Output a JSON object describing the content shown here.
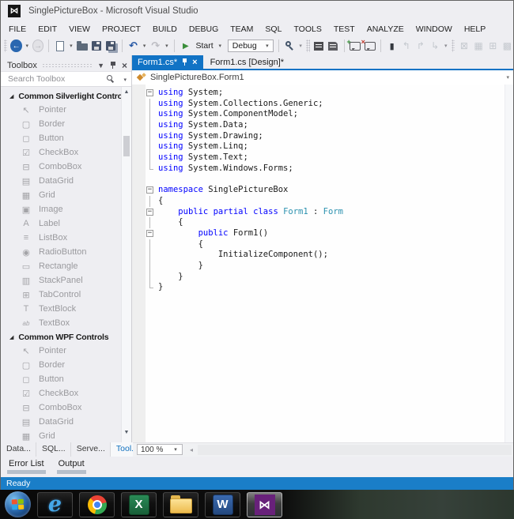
{
  "window": {
    "title": "SinglePictureBox - Microsoft Visual Studio"
  },
  "menu": [
    "FILE",
    "EDIT",
    "VIEW",
    "PROJECT",
    "BUILD",
    "DEBUG",
    "TEAM",
    "SQL",
    "TOOLS",
    "TEST",
    "ANALYZE",
    "WINDOW",
    "HELP"
  ],
  "toolbar": {
    "start_label": "Start",
    "debug_value": "Debug"
  },
  "icons": {
    "vs_logo": "⋈",
    "back": "←",
    "forward": "→",
    "caret": "▾",
    "undo": "↶",
    "redo": "↷",
    "start": "▶",
    "bookmark": "▮",
    "prev_bookmark": "↰",
    "next_bookmark": "↱",
    "clear_bookmarks": "↳",
    "grid1": "⊠",
    "grid2": "▦",
    "grid3": "⊞",
    "grid4": "▩",
    "expander": "◢",
    "fold": "−",
    "close": "×",
    "plus": "+",
    "cross": "×",
    "scroll_up": "▲",
    "scroll_down": "▼",
    "hscroll_left": "◂",
    "crumb_caret": "▾",
    "search_caret": "▾"
  },
  "toolbox": {
    "title": "Toolbox",
    "search_placeholder": "Search Toolbox",
    "groups": [
      {
        "label": "Common Silverlight Controls",
        "items": [
          {
            "label": "Pointer",
            "icon": "pointer-icon",
            "glyph": "↖"
          },
          {
            "label": "Border",
            "icon": "border-icon",
            "glyph": "▢"
          },
          {
            "label": "Button",
            "icon": "button-icon",
            "glyph": "◻"
          },
          {
            "label": "CheckBox",
            "icon": "checkbox-icon",
            "glyph": "☑"
          },
          {
            "label": "ComboBox",
            "icon": "combobox-icon",
            "glyph": "⊟"
          },
          {
            "label": "DataGrid",
            "icon": "datagrid-icon",
            "glyph": "▤"
          },
          {
            "label": "Grid",
            "icon": "grid-icon",
            "glyph": "▦"
          },
          {
            "label": "Image",
            "icon": "image-icon",
            "glyph": "▣"
          },
          {
            "label": "Label",
            "icon": "label-icon",
            "glyph": "A"
          },
          {
            "label": "ListBox",
            "icon": "listbox-icon",
            "glyph": "≡"
          },
          {
            "label": "RadioButton",
            "icon": "radiobutton-icon",
            "glyph": "◉"
          },
          {
            "label": "Rectangle",
            "icon": "rectangle-icon",
            "glyph": "▭"
          },
          {
            "label": "StackPanel",
            "icon": "stackpanel-icon",
            "glyph": "▥"
          },
          {
            "label": "TabControl",
            "icon": "tabcontrol-icon",
            "glyph": "⊞"
          },
          {
            "label": "TextBlock",
            "icon": "textblock-icon",
            "glyph": "T"
          },
          {
            "label": "TextBox",
            "icon": "textbox-icon",
            "glyph": "ab"
          }
        ]
      },
      {
        "label": "Common WPF Controls",
        "items": [
          {
            "label": "Pointer",
            "icon": "pointer-icon",
            "glyph": "↖"
          },
          {
            "label": "Border",
            "icon": "border-icon",
            "glyph": "▢"
          },
          {
            "label": "Button",
            "icon": "button-icon",
            "glyph": "◻"
          },
          {
            "label": "CheckBox",
            "icon": "checkbox-icon",
            "glyph": "☑"
          },
          {
            "label": "ComboBox",
            "icon": "combobox-icon",
            "glyph": "⊟"
          },
          {
            "label": "DataGrid",
            "icon": "datagrid-icon",
            "glyph": "▤"
          },
          {
            "label": "Grid",
            "icon": "grid-icon",
            "glyph": "▦"
          }
        ]
      }
    ]
  },
  "editor": {
    "tabs": [
      {
        "label": "Form1.cs*",
        "active": true
      },
      {
        "label": "Form1.cs [Design]*",
        "active": false
      }
    ],
    "breadcrumb": "SinglePictureBox.Form1",
    "zoom": "100 %",
    "code": [
      {
        "g": "box",
        "t": [
          [
            "k",
            "using"
          ],
          [
            "p",
            " System;"
          ]
        ]
      },
      {
        "g": "line",
        "t": [
          [
            "k",
            "using"
          ],
          [
            "p",
            " System.Collections.Generic;"
          ]
        ]
      },
      {
        "g": "line",
        "t": [
          [
            "k",
            "using"
          ],
          [
            "p",
            " System.ComponentModel;"
          ]
        ]
      },
      {
        "g": "line",
        "t": [
          [
            "k",
            "using"
          ],
          [
            "p",
            " System.Data;"
          ]
        ]
      },
      {
        "g": "line",
        "t": [
          [
            "k",
            "using"
          ],
          [
            "p",
            " System.Drawing;"
          ]
        ]
      },
      {
        "g": "line",
        "t": [
          [
            "k",
            "using"
          ],
          [
            "p",
            " System.Linq;"
          ]
        ]
      },
      {
        "g": "line",
        "t": [
          [
            "k",
            "using"
          ],
          [
            "p",
            " System.Text;"
          ]
        ]
      },
      {
        "g": "end",
        "t": [
          [
            "k",
            "using"
          ],
          [
            "p",
            " System.Windows.Forms;"
          ]
        ]
      },
      {
        "g": "",
        "t": []
      },
      {
        "g": "box",
        "t": [
          [
            "k",
            "namespace"
          ],
          [
            "p",
            " SinglePictureBox"
          ]
        ]
      },
      {
        "g": "line",
        "t": [
          [
            "p",
            "{"
          ]
        ]
      },
      {
        "g": "box",
        "t": [
          [
            "p",
            "    "
          ],
          [
            "k",
            "public"
          ],
          [
            "p",
            " "
          ],
          [
            "k",
            "partial"
          ],
          [
            "p",
            " "
          ],
          [
            "k",
            "class"
          ],
          [
            "p",
            " "
          ],
          [
            "y",
            "Form1"
          ],
          [
            "p",
            " : "
          ],
          [
            "y",
            "Form"
          ]
        ]
      },
      {
        "g": "line",
        "t": [
          [
            "p",
            "    {"
          ]
        ]
      },
      {
        "g": "box",
        "t": [
          [
            "p",
            "        "
          ],
          [
            "k",
            "public"
          ],
          [
            "p",
            " Form1()"
          ]
        ]
      },
      {
        "g": "line",
        "t": [
          [
            "p",
            "        {"
          ]
        ]
      },
      {
        "g": "line",
        "t": [
          [
            "p",
            "            InitializeComponent();"
          ]
        ]
      },
      {
        "g": "line",
        "t": [
          [
            "p",
            "        }"
          ]
        ]
      },
      {
        "g": "line",
        "t": [
          [
            "p",
            "    }"
          ]
        ]
      },
      {
        "g": "end",
        "t": [
          [
            "p",
            "}"
          ]
        ]
      }
    ]
  },
  "bottom_tabs": [
    {
      "label": "Data...",
      "active": false
    },
    {
      "label": "SQL...",
      "active": false
    },
    {
      "label": "Serve...",
      "active": false
    },
    {
      "label": "Tool...",
      "active": true
    }
  ],
  "panel_tabs": [
    "Error List",
    "Output"
  ],
  "status": "Ready",
  "taskbar": [
    {
      "name": "start"
    },
    {
      "name": "internet-explorer",
      "letter": "e"
    },
    {
      "name": "chrome"
    },
    {
      "name": "excel",
      "letter": "X"
    },
    {
      "name": "file-explorer"
    },
    {
      "name": "word",
      "letter": "W"
    },
    {
      "name": "visual-studio",
      "glyph": "⋈",
      "active": true
    }
  ],
  "colors": {
    "accent": "#1173c5",
    "keyword": "#0000ff",
    "type": "#2b91af",
    "status_bg": "#1a7ec8",
    "vs_purple": "#68217a",
    "chrome_bg": "#eeeef2"
  }
}
